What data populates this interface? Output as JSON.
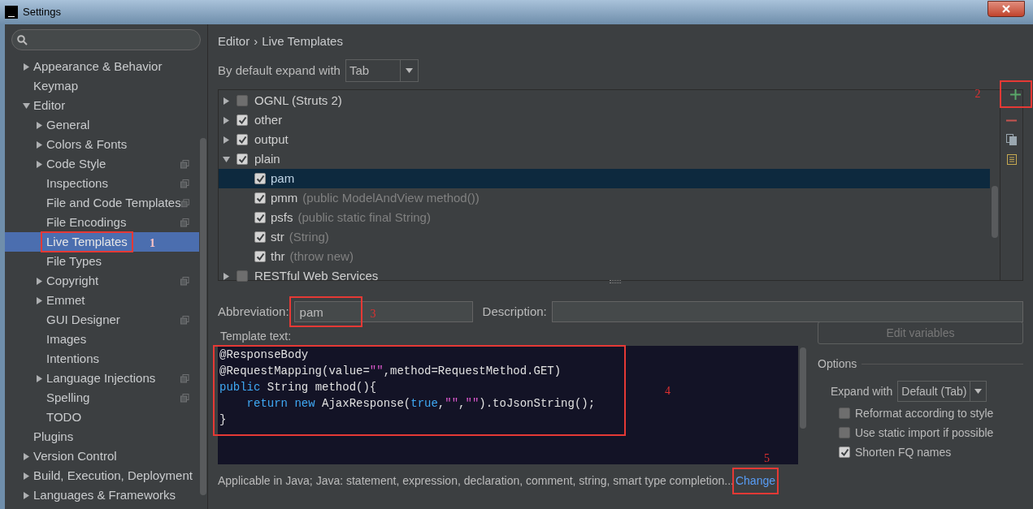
{
  "window": {
    "title": "Settings"
  },
  "sidebar": {
    "items": [
      {
        "label": "Appearance & Behavior",
        "expanded": false,
        "selected": false
      },
      {
        "label": "Keymap",
        "selected": false
      },
      {
        "label": "Editor",
        "expanded": true,
        "selected": false,
        "children": [
          {
            "label": "General",
            "expanded": false,
            "selected": false,
            "project_level": false
          },
          {
            "label": "Colors & Fonts",
            "expanded": false,
            "selected": false,
            "project_level": false
          },
          {
            "label": "Code Style",
            "expanded": false,
            "selected": false,
            "project_level": true
          },
          {
            "label": "Inspections",
            "selected": false,
            "project_level": true
          },
          {
            "label": "File and Code Templates",
            "selected": false,
            "project_level": true
          },
          {
            "label": "File Encodings",
            "selected": false,
            "project_level": true
          },
          {
            "label": "Live Templates",
            "selected": true,
            "project_level": false,
            "callout": "1"
          },
          {
            "label": "File Types",
            "selected": false,
            "project_level": false
          },
          {
            "label": "Copyright",
            "expanded": false,
            "selected": false,
            "project_level": true
          },
          {
            "label": "Emmet",
            "expanded": false,
            "selected": false,
            "project_level": false
          },
          {
            "label": "GUI Designer",
            "selected": false,
            "project_level": true
          },
          {
            "label": "Images",
            "selected": false,
            "project_level": false
          },
          {
            "label": "Intentions",
            "selected": false,
            "project_level": false
          },
          {
            "label": "Language Injections",
            "expanded": false,
            "selected": false,
            "project_level": true
          },
          {
            "label": "Spelling",
            "selected": false,
            "project_level": true
          },
          {
            "label": "TODO",
            "selected": false,
            "project_level": false
          }
        ]
      },
      {
        "label": "Plugins",
        "selected": false
      },
      {
        "label": "Version Control",
        "expanded": false,
        "selected": false
      },
      {
        "label": "Build, Execution, Deployment",
        "expanded": false,
        "selected": false
      },
      {
        "label": "Languages & Frameworks",
        "expanded": false,
        "selected": false
      }
    ]
  },
  "breadcrumb": [
    "Editor",
    "›",
    "Live Templates"
  ],
  "expand_default": {
    "label": "By default expand with",
    "value": "Tab"
  },
  "templates": [
    {
      "name": "OGNL (Struts 2)",
      "checked": false,
      "expanded": false
    },
    {
      "name": "other",
      "checked": true,
      "expanded": false
    },
    {
      "name": "output",
      "checked": true,
      "expanded": false
    },
    {
      "name": "plain",
      "checked": true,
      "expanded": true,
      "children": [
        {
          "abbreviation": "pam",
          "checked": true,
          "selected": true
        },
        {
          "abbreviation": "pmm",
          "description": "(public ModelAndView method())",
          "checked": true,
          "selected": false
        },
        {
          "abbreviation": "psfs",
          "description": "(public static final String)",
          "checked": true,
          "selected": false
        },
        {
          "abbreviation": "str",
          "description": "(String)",
          "checked": true,
          "selected": false
        },
        {
          "abbreviation": "thr",
          "description": "(throw new)",
          "checked": true,
          "selected": false
        }
      ]
    },
    {
      "name": "RESTful Web Services",
      "checked": false,
      "expanded": false
    }
  ],
  "toolbar": [
    {
      "kind": "add",
      "callout": "2"
    },
    {
      "kind": "remove"
    },
    {
      "kind": "copy"
    },
    {
      "kind": "group"
    }
  ],
  "abbreviation": {
    "label": "Abbreviation:",
    "value": "pam",
    "callout": "3"
  },
  "description": {
    "label": "Description:"
  },
  "template_text": {
    "label": "Template text:",
    "callout": "4",
    "lines": [
      [
        {
          "text": "@ResponseBody",
          "kind": "plain"
        }
      ],
      [
        {
          "text": "@RequestMapping(value=",
          "kind": "plain"
        },
        {
          "text": "\"\"",
          "kind": "string"
        },
        {
          "text": ",method=RequestMethod.GET)",
          "kind": "plain"
        }
      ],
      [
        {
          "text": "public",
          "kind": "keyword"
        },
        {
          "text": " String method(){",
          "kind": "plain"
        }
      ],
      [
        {
          "text": "    return new",
          "kind": "keyword"
        },
        {
          "text": " AjaxResponse(",
          "kind": "plain"
        },
        {
          "text": "true",
          "kind": "keyword"
        },
        {
          "text": ",",
          "kind": "plain"
        },
        {
          "text": "\"\"",
          "kind": "string"
        },
        {
          "text": ",",
          "kind": "plain"
        },
        {
          "text": "\"\"",
          "kind": "string"
        },
        {
          "text": ").toJsonString();",
          "kind": "plain"
        }
      ],
      [
        {
          "text": "}",
          "kind": "plain"
        }
      ]
    ]
  },
  "edit_variables": {
    "label": "Edit variables",
    "disabled": true
  },
  "options": {
    "title": "Options",
    "expand_with": {
      "label": "Expand with",
      "value": "Default (Tab)"
    },
    "checkboxes": [
      {
        "label": "Reformat according to style",
        "checked": false
      },
      {
        "label": "Use static import if possible",
        "checked": false
      },
      {
        "label": "Shorten FQ names",
        "checked": true
      }
    ]
  },
  "context": {
    "text": "Applicable in Java; Java: statement, expression, declaration, comment, string, smart type completion...",
    "link": "Change",
    "callout": "5"
  }
}
